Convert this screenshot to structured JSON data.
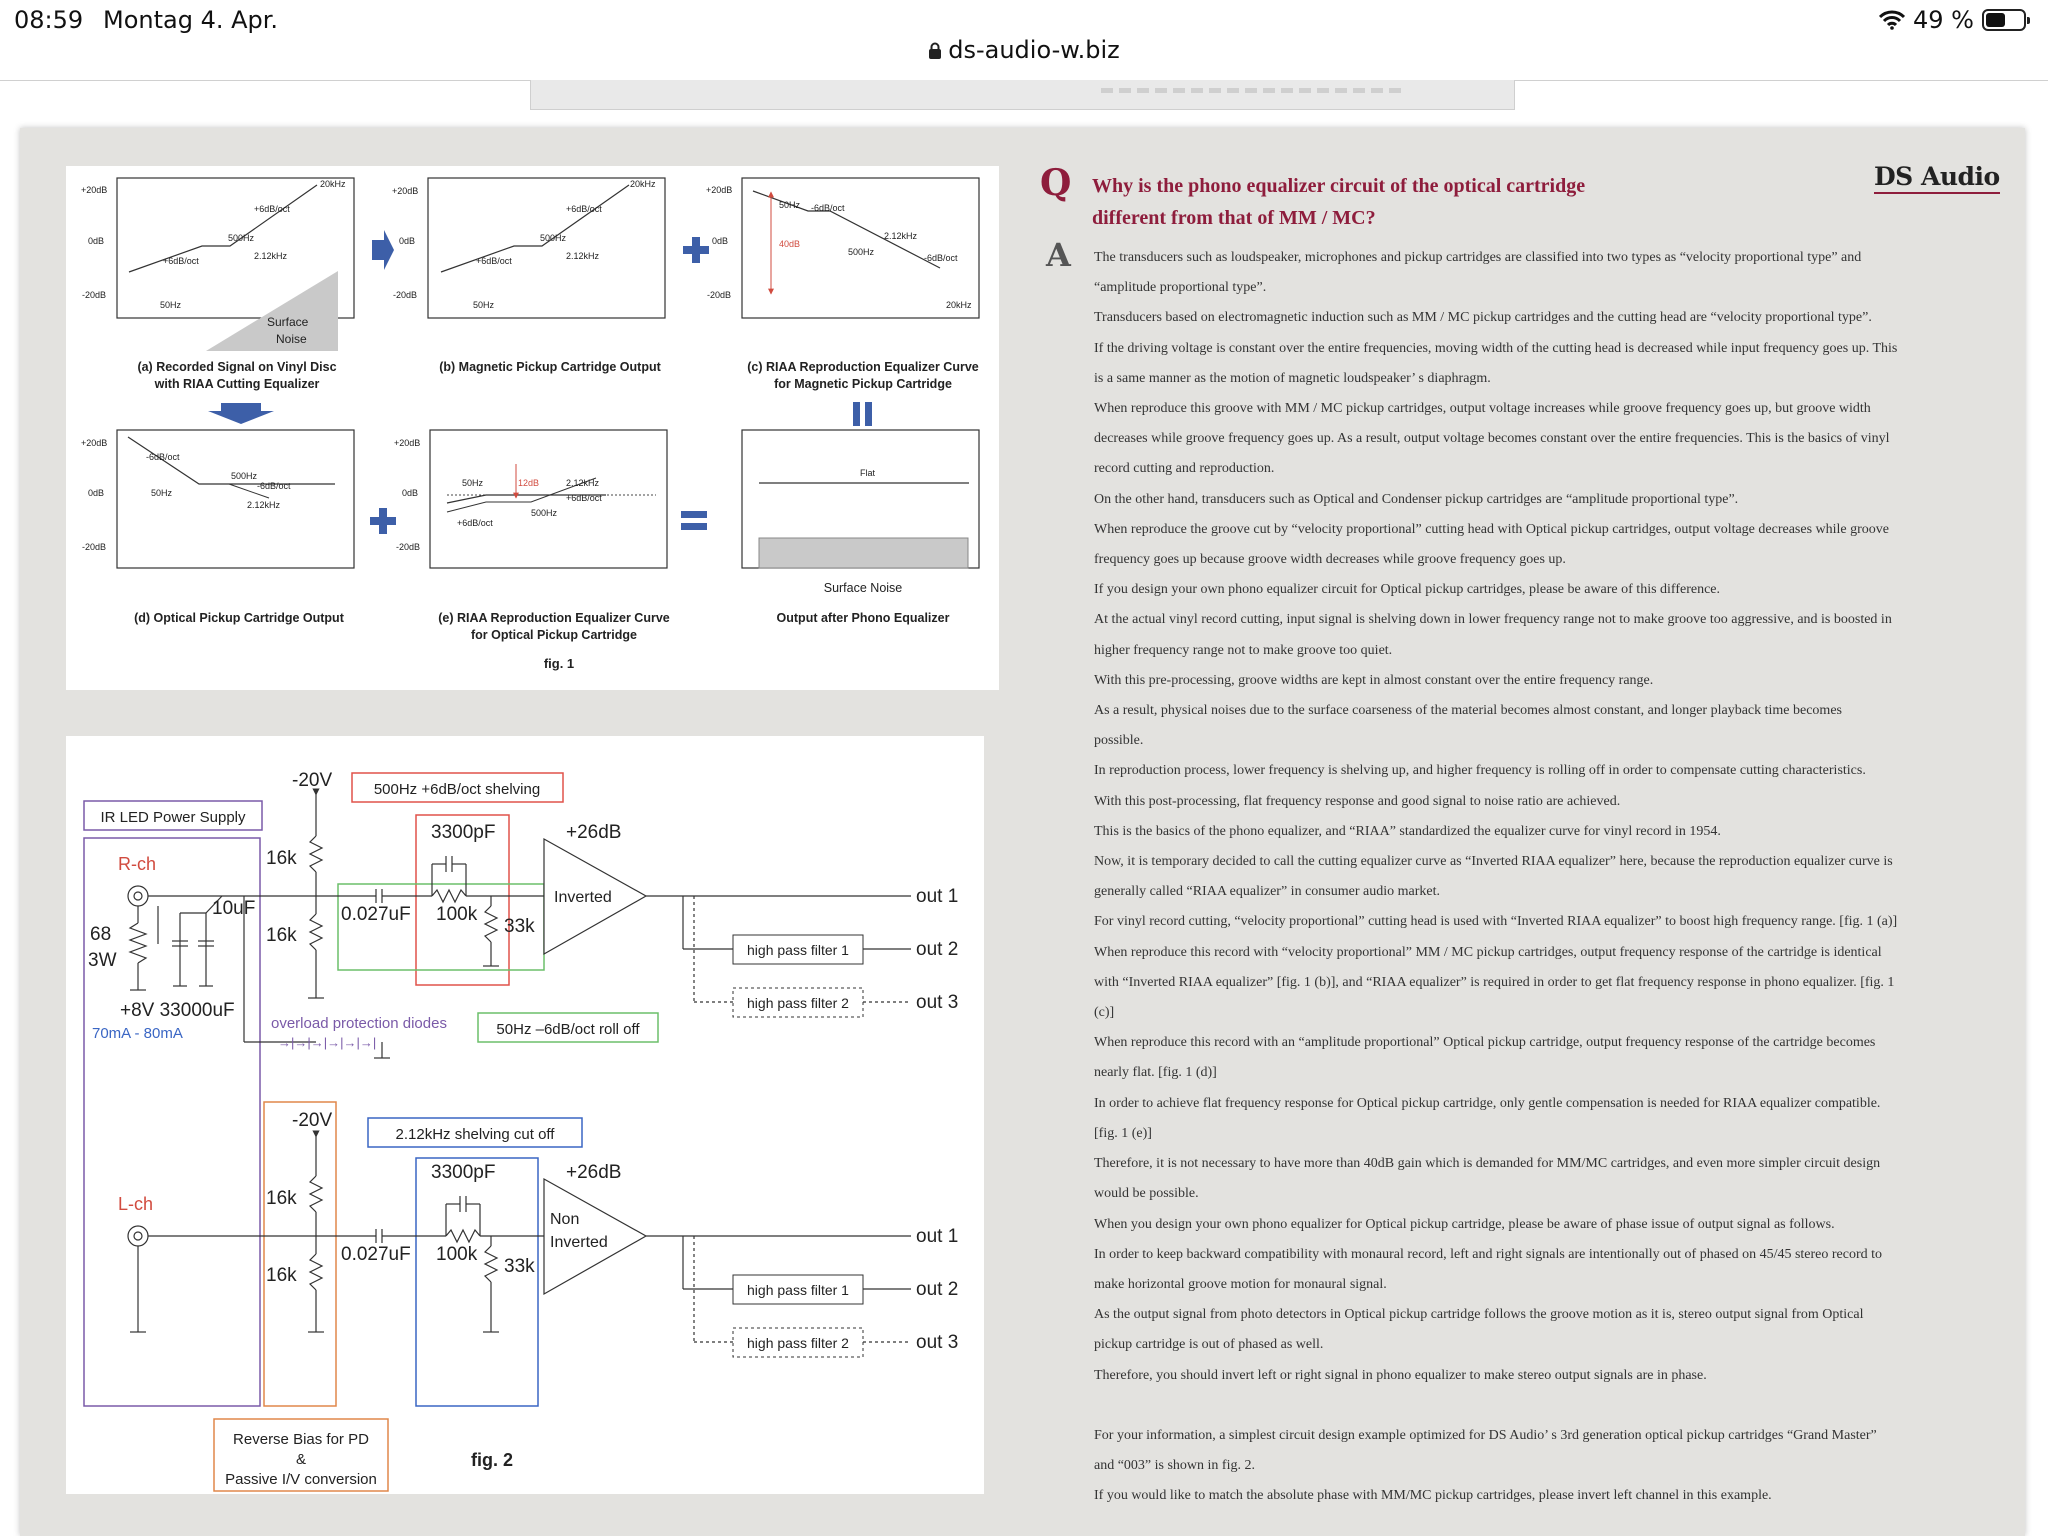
{
  "status_bar": {
    "time": "08:59",
    "date": "Montag 4. Apr.",
    "battery_text": "49 %",
    "battery_level": 0.49
  },
  "browser": {
    "url": "ds-audio-w.biz"
  },
  "logo": {
    "text": "DS Audio"
  },
  "qa": {
    "q_mark": "Q",
    "a_mark": "A",
    "question_line1": "Why is the phono equalizer circuit of the optical cartridge",
    "question_line2": "different from that of MM / MC?",
    "answer_lines": [
      "The transducers such as loudspeaker, microphones and pickup cartridges are classified into two types as “velocity proportional type” and",
      "“amplitude proportional type”.",
      "Transducers based on electromagnetic induction such as MM / MC pickup cartridges and the cutting head are “velocity proportional type”.",
      "If the driving voltage is constant over the entire frequencies, moving width of the cutting head is decreased while input frequency goes up. This",
      "is a same manner as the motion of magnetic loudspeaker’ s diaphragm.",
      "When reproduce this groove with MM / MC pickup cartridges, output voltage increases while groove frequency goes up, but groove width",
      "decreases while groove frequency goes up. As a result, output voltage becomes constant over the entire frequencies. This is the basics of vinyl",
      "record cutting and reproduction.",
      "On the other hand, transducers such as Optical and Condenser pickup cartridges are “amplitude proportional type”.",
      "When reproduce the groove cut by “velocity proportional” cutting head with Optical pickup cartridges, output voltage decreases while groove",
      "frequency goes up because groove width decreases while groove frequency goes up.",
      "If you design your own phono equalizer circuit for Optical pickup cartridges, please be aware of this difference.",
      "At the actual vinyl record cutting, input signal is shelving down in lower frequency range not to make groove too aggressive, and is boosted in",
      "higher frequency range not to make groove too quiet.",
      "With this pre-processing, groove widths are kept in almost constant over the entire frequency range.",
      "As a result, physical noises due to the surface coarseness of the material becomes almost constant, and longer playback time becomes",
      "possible.",
      "In reproduction process, lower frequency is shelving up, and higher frequency is rolling off in order to compensate cutting characteristics.",
      "With this post-processing, flat frequency response and good signal to noise ratio are achieved.",
      "This is the basics of the phono equalizer, and “RIAA” standardized the equalizer curve for vinyl record in 1954.",
      "Now, it is temporary decided to call the cutting equalizer curve as “Inverted RIAA equalizer” here, because the reproduction equalizer curve is",
      "generally called “RIAA equalizer” in consumer audio market.",
      "For vinyl record cutting, “velocity proportional” cutting head is used with “Inverted RIAA equalizer” to boost high frequency range. [fig. 1 (a)]",
      "When reproduce this record with “velocity proportional” MM / MC pickup cartridges, output frequency response of the cartridge is identical",
      "with “Inverted RIAA equalizer” [fig. 1 (b)], and “RIAA equalizer” is required in order to get flat frequency response in phono equalizer. [fig. 1",
      "(c)]",
      "When reproduce this record with an “amplitude proportional” Optical pickup cartridge, output frequency response of the cartridge becomes",
      "nearly flat. [fig. 1 (d)]",
      "In order to achieve flat frequency response for Optical pickup cartridge, only gentle compensation is needed for RIAA equalizer compatible.",
      "[fig. 1 (e)]",
      "Therefore, it is not necessary to have more than 40dB gain which is demanded for MM/MC cartridges, and even more simpler circuit design",
      "would be possible.",
      "When you design your own phono equalizer for Optical pickup cartridge, please be aware of phase issue of output signal as follows.",
      "In order to keep backward compatibility with monaural record, left and right signals are intentionally out of phased on 45/45 stereo record to",
      "make horizontal groove motion for monaural signal.",
      "As the output signal from photo detectors in Optical pickup cartridge follows the groove motion as it is, stereo output signal from Optical",
      "pickup cartridge is out of phased as well.",
      "Therefore, you should invert left or right signal in phono equalizer to make stereo output signals are in phase.",
      "",
      "For your information, a simplest circuit design example optimized for DS Audio’ s 3rd generation optical pickup cartridges “Grand Master”",
      "and “003” is shown in fig. 2.",
      "If you would like to match the absolute phase with MM/MC pickup cartridges, please invert left channel in this example."
    ]
  },
  "fig1": {
    "y_labels": [
      "+20dB",
      "0dB",
      "-20dB"
    ],
    "panel_a": {
      "caption1": "(a) Recorded Signal on Vinyl Disc",
      "caption2": "with RIAA Cutting Equalizer",
      "labels": [
        "20kHz",
        "+6dB/oct",
        "500Hz",
        "2.12kHz",
        "+6dB/oct",
        "50Hz"
      ],
      "noise1": "Surface",
      "noise2": "Noise"
    },
    "panel_b": {
      "caption1": "(b) Magnetic Pickup Cartridge Output",
      "labels": [
        "20kHz",
        "+6dB/oct",
        "500Hz",
        "2.12kHz",
        "+6dB/oct",
        "50Hz"
      ]
    },
    "panel_c": {
      "caption1": "(c) RIAA Reproduction Equalizer Curve",
      "caption2": "for Magnetic Pickup Cartridge",
      "labels": [
        "50Hz",
        "-6dB/oct",
        "2.12kHz",
        "500Hz",
        "-6dB/oct",
        "20kHz"
      ],
      "gain": "40dB"
    },
    "panel_d": {
      "caption1": "(d) Optical Pickup Cartridge Output",
      "labels": [
        "-6dB/oct",
        "500Hz",
        "-6dB/oct",
        "50Hz",
        "2.12kHz"
      ]
    },
    "panel_e": {
      "caption1": "(e) RIAA Reproduction Equalizer Curve",
      "caption2": "for Optical Pickup Cartridge",
      "labels": [
        "50Hz",
        "2.12kHz",
        "+6dB/oct",
        "500Hz",
        "+6dB/oct"
      ],
      "gain": "12dB"
    },
    "panel_out": {
      "caption1": "Output after Phono Equalizer",
      "flat": "Flat",
      "noise": "Surface Noise"
    },
    "fig_label": "fig. 1"
  },
  "fig2": {
    "ir_led": "IR LED Power Supply",
    "r_ch": "R-ch",
    "l_ch": "L-ch",
    "neg20v": "-20V",
    "r16k_top": "16k",
    "r16k_bot": "16k",
    "c10uf": "10uF",
    "r68": "68",
    "r3w": "3W",
    "c33000": "+8V 33000uF",
    "current": "70mA - 80mA",
    "overload": "overload protection diodes",
    "diodes": "→|→|→|→|→|→|",
    "shelf500": "500Hz +6dB/oct shelving",
    "c3300": "3300pF",
    "gain26": "+26dB",
    "c027": "0.027uF",
    "r100k": "100k",
    "r33k": "33k",
    "inverted": "Inverted",
    "non": "Non",
    "rolloff50": "50Hz –6dB/oct roll off",
    "shelf212": "2.12kHz shelving cut off",
    "hpf1": "high pass filter 1",
    "hpf2": "high pass filter 2",
    "out1": "out 1",
    "out2": "out 2",
    "out3": "out 3",
    "reverse1": "Reverse Bias for PD",
    "reverse2": "&",
    "reverse3": "Passive I/V conversion",
    "fig_label": "fig. 2"
  },
  "colors": {
    "accent": "#8e1d3c",
    "red_box": "#e0524a",
    "green_box": "#6cbf6a",
    "blue_box": "#3a66c4",
    "purple_box": "#7a5aa8",
    "orange_box": "#e0874a",
    "arrow_blue": "#3d5fa8"
  }
}
